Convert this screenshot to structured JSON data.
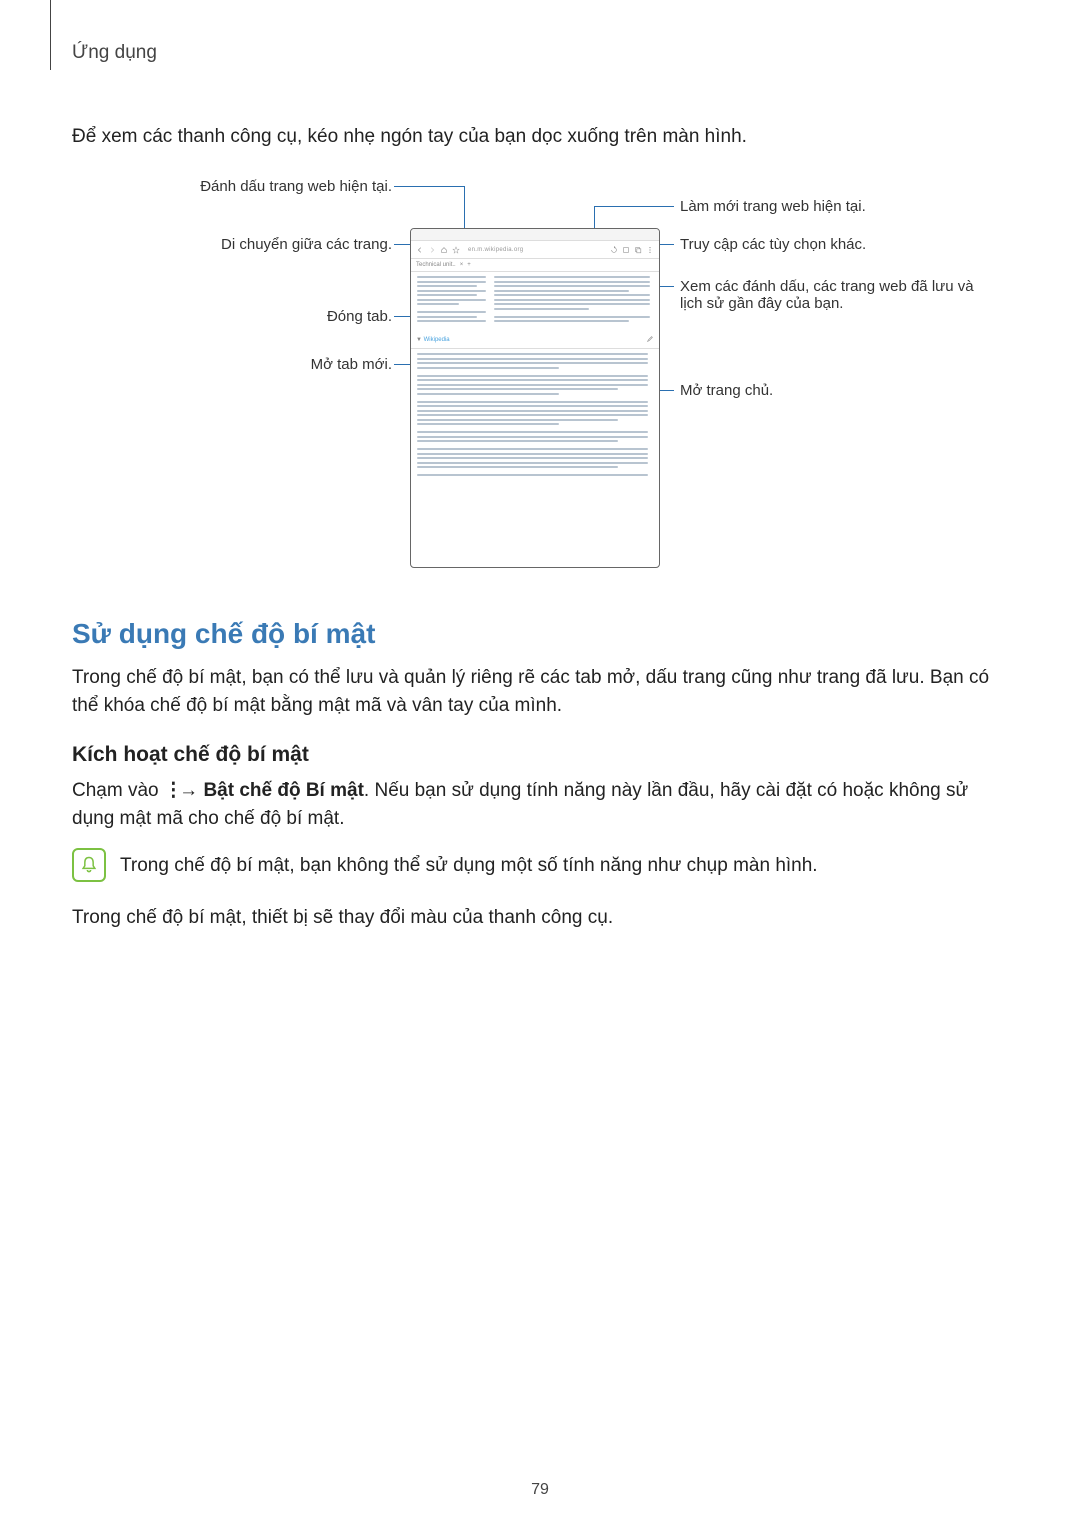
{
  "header": {
    "title": "Ứng dụng"
  },
  "intro": "Để xem các thanh công cụ, kéo nhẹ ngón tay của bạn dọc xuống trên màn hình.",
  "callouts": {
    "left1": "Đánh dấu trang web hiện tại.",
    "left2": "Di chuyển giữa các trang.",
    "left3": "Đóng tab.",
    "left4": "Mở tab mới.",
    "right1": "Làm mới trang web hiện tại.",
    "right2": "Truy cập các tùy chọn khác.",
    "right3": "Xem các đánh dấu, các trang web đã lưu và lịch sử gần đây của bạn.",
    "right4": "Mở trang chủ.",
    "tab_link": "Wikipedia"
  },
  "section": {
    "title": "Sử dụng chế độ bí mật",
    "p1": "Trong chế độ bí mật, bạn có thể lưu và quản lý riêng rẽ các tab mở, dấu trang cũng như trang đã lưu. Bạn có thể khóa chế độ bí mật bằng mật mã và vân tay của mình."
  },
  "sub": {
    "title": "Kích hoạt chế độ bí mật",
    "p_before": "Chạm vào ",
    "p_bold": "Bật chế độ Bí mật",
    "p_after": ". Nếu bạn sử dụng tính năng này lần đầu, hãy cài đặt có hoặc không sử dụng mật mã cho chế độ bí mật.",
    "arrow": " → ",
    "note": "Trong chế độ bí mật, bạn không thể sử dụng một số tính năng như chụp màn hình.",
    "p2": "Trong chế độ bí mật, thiết bị sẽ thay đổi màu của thanh công cụ."
  },
  "page_number": "79"
}
